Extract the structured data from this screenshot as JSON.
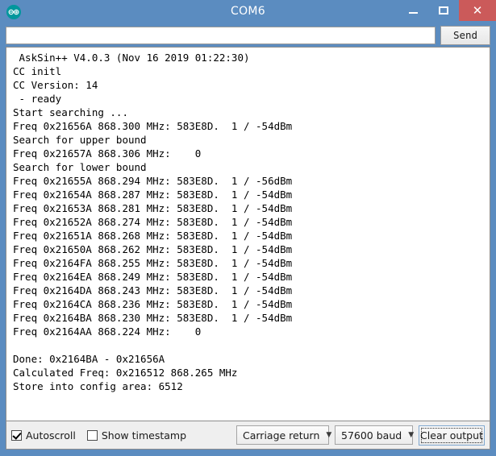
{
  "window": {
    "title": "COM6",
    "logo_icon": "arduino-infinity-icon",
    "minimize_icon": "minimize-icon",
    "maximize_icon": "maximize-icon",
    "close_icon": "close-icon",
    "close_color": "#cb5a5a",
    "titlebar_color": "#5b8cc0"
  },
  "send_bar": {
    "input_value": "",
    "input_placeholder": "",
    "send_label": "Send"
  },
  "console": {
    "lines": [
      " AskSin++ V4.0.3 (Nov 16 2019 01:22:30)",
      "CC initl",
      "CC Version: 14",
      " - ready",
      "Start searching ...",
      "Freq 0x21656A 868.300 MHz: 583E8D.  1 / -54dBm",
      "Search for upper bound",
      "Freq 0x21657A 868.306 MHz:    0",
      "Search for lower bound",
      "Freq 0x21655A 868.294 MHz: 583E8D.  1 / -56dBm",
      "Freq 0x21654A 868.287 MHz: 583E8D.  1 / -54dBm",
      "Freq 0x21653A 868.281 MHz: 583E8D.  1 / -54dBm",
      "Freq 0x21652A 868.274 MHz: 583E8D.  1 / -54dBm",
      "Freq 0x21651A 868.268 MHz: 583E8D.  1 / -54dBm",
      "Freq 0x21650A 868.262 MHz: 583E8D.  1 / -54dBm",
      "Freq 0x2164FA 868.255 MHz: 583E8D.  1 / -54dBm",
      "Freq 0x2164EA 868.249 MHz: 583E8D.  1 / -54dBm",
      "Freq 0x2164DA 868.243 MHz: 583E8D.  1 / -54dBm",
      "Freq 0x2164CA 868.236 MHz: 583E8D.  1 / -54dBm",
      "Freq 0x2164BA 868.230 MHz: 583E8D.  1 / -54dBm",
      "Freq 0x2164AA 868.224 MHz:    0",
      "",
      "Done: 0x2164BA - 0x21656A",
      "Calculated Freq: 0x216512 868.265 MHz",
      "Store into config area: 6512"
    ]
  },
  "toolbar": {
    "autoscroll_label": "Autoscroll",
    "autoscroll_checked": true,
    "timestamp_label": "Show timestamp",
    "timestamp_checked": false,
    "line_ending_value": "Carriage return",
    "baud_value": "57600 baud",
    "clear_label": "Clear output",
    "dropdown_icon": "chevron-down-icon"
  }
}
